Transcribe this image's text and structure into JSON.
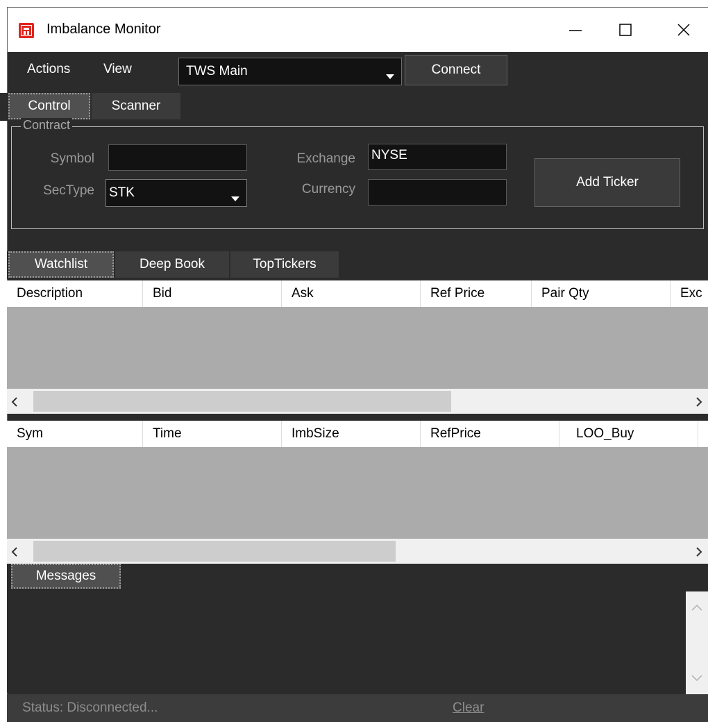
{
  "window": {
    "title": "Imbalance Monitor",
    "controls": {
      "minimize": "minimize-icon",
      "maximize": "maximize-icon",
      "close": "close-icon"
    }
  },
  "menu": {
    "actions": "Actions",
    "view": "View",
    "connection_select": "TWS Main",
    "connect_label": "Connect"
  },
  "top_tabs": [
    {
      "label": "Control",
      "active": true
    },
    {
      "label": "Scanner",
      "active": false
    }
  ],
  "contract": {
    "legend": "Contract",
    "symbol_label": "Symbol",
    "symbol_value": "",
    "sectype_label": "SecType",
    "sectype_value": "STK",
    "exchange_label": "Exchange",
    "exchange_value": "NYSE",
    "currency_label": "Currency",
    "currency_value": "",
    "add_ticker_label": "Add Ticker"
  },
  "data_tabs": [
    {
      "label": "Watchlist",
      "active": true
    },
    {
      "label": "Deep Book",
      "active": false
    },
    {
      "label": "TopTickers",
      "active": false
    }
  ],
  "watchlist_grid": {
    "columns": [
      "Description",
      "Bid",
      "Ask",
      "Ref Price",
      "Pair Qty",
      "Exc"
    ],
    "rows": []
  },
  "imbalance_grid": {
    "columns": [
      "Sym",
      "Time",
      "ImbSize",
      "RefPrice",
      "LOO_Buy"
    ],
    "rows": []
  },
  "messages": {
    "tab_label": "Messages",
    "content": ""
  },
  "status": {
    "text": "Status:  Disconnected...",
    "clear_label": "Clear"
  },
  "colors": {
    "window_bg": "#2b2b2b",
    "input_bg": "#121212",
    "grid_body": "#ababab",
    "app_icon": "#e0261f"
  }
}
